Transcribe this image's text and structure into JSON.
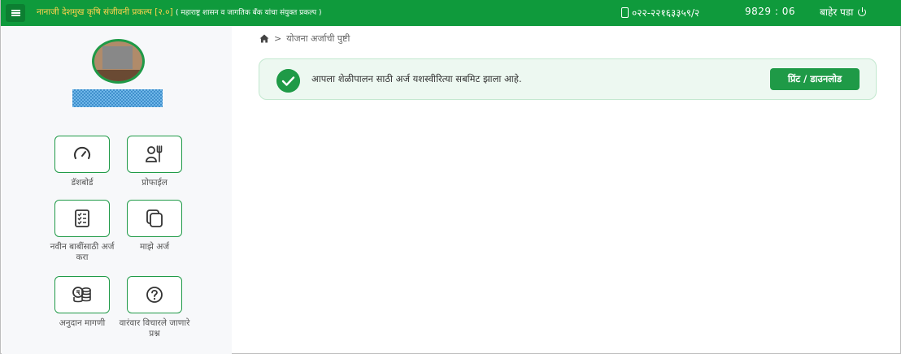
{
  "header": {
    "title": "नानाजी देशमुख कृषि संजीवनी प्रकल्प [२.०]",
    "subtitle": "( महाराष्ट्र शासन व जागतिक बँक यांचा संयुक्त प्रकल्प )",
    "phone": "०२२-२२१६३३५९/२",
    "counter": "9829 : 06",
    "logout_label": "बाहेर पडा",
    "icons": {
      "menu": "menu-icon",
      "phone": "phone-icon",
      "logout": "power-icon"
    },
    "colors": {
      "bar": "#0f9a3c",
      "title": "#ffd24d"
    }
  },
  "sidebar": {
    "tiles": [
      {
        "label": "डॅशबोर्ड",
        "icon": "dashboard-gauge-icon"
      },
      {
        "label": "प्रोफाईल",
        "icon": "farmer-profile-icon"
      },
      {
        "label": "नवीन बाबींसाठी अर्ज करा",
        "icon": "checklist-icon"
      },
      {
        "label": "माझे अर्ज",
        "icon": "copy-documents-icon"
      },
      {
        "label": "अनुदान मागणी",
        "icon": "coins-icon"
      },
      {
        "label": "वारंवार विचारले जाणारे प्रश्न",
        "icon": "question-icon"
      }
    ]
  },
  "breadcrumb": {
    "icon": "home-icon",
    "separator": ">",
    "current": "योजना अर्जाची पुष्टी"
  },
  "alert": {
    "message": "आपला शेळीपालन साठी अर्ज यशस्वीरित्या सबमिट झाला आहे.",
    "icon": "check-circle-icon",
    "button_label": "प्रिंट / डाउनलोड"
  },
  "colors": {
    "accent": "#1f9a47",
    "alert_bg": "#edf8f1"
  }
}
